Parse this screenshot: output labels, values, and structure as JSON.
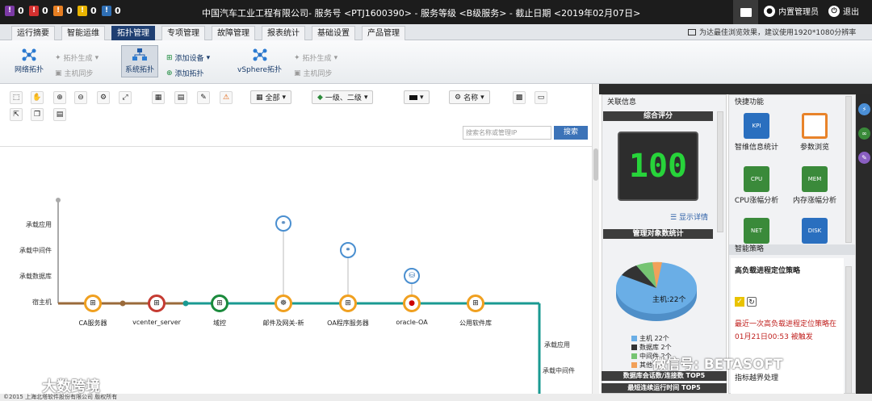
{
  "alarms": [
    {
      "color": "#7c3aa6",
      "count": "0",
      "icon": "alarm-critical-icon"
    },
    {
      "color": "#d3302f",
      "count": "0",
      "icon": "alarm-major-icon"
    },
    {
      "color": "#e67e22",
      "count": "0",
      "icon": "alarm-minor-icon"
    },
    {
      "color": "#e9b400",
      "count": "0",
      "icon": "alarm-warning-icon"
    },
    {
      "color": "#2f6fb5",
      "count": "0",
      "icon": "alarm-info-icon"
    }
  ],
  "header": {
    "title": "中国汽车工业工程有限公司- 服务号 <PTJ1600390> - 服务等级 <B级服务> - 截止日期 <2019年02月07日>",
    "user": "内置管理员",
    "logout": "退出",
    "hint": "为达最佳浏览效果，建议使用1920*1080分辨率"
  },
  "tabs": [
    "运行摘要",
    "智能运维",
    "拓扑管理",
    "专项管理",
    "故障管理",
    "报表统计",
    "基础设置",
    "产品管理"
  ],
  "active_tab": "拓扑管理",
  "ribbon": {
    "network_topo": "网络拓扑",
    "topo_gen": "拓扑生成",
    "host_sync": "主机同步",
    "system_topo": "系统拓扑",
    "add_device": "添加设备",
    "add_topo": "添加拓扑",
    "vsphere_topo": "vSphere拓扑",
    "topo_gen2": "拓扑生成",
    "host_sync2": "主机同步"
  },
  "toolbar": {
    "dd_all": "全部",
    "dd_level": "一级、二级",
    "dd_name": "名称",
    "search_placeholder": "搜索名称或管理IP",
    "search_btn": "搜索"
  },
  "lanes": {
    "left": [
      "承载应用",
      "承载中间件",
      "承载数据库",
      "宿主机"
    ],
    "right": [
      "承载应用",
      "承载中间件"
    ]
  },
  "nodes": [
    {
      "label": "CA服务器"
    },
    {
      "label": "vcenter_server"
    },
    {
      "label": "域控"
    },
    {
      "label": "邮件及网关-新"
    },
    {
      "label": "OA程序服务器"
    },
    {
      "label": "oracle-OA"
    },
    {
      "label": "公用软件库"
    }
  ],
  "related": {
    "title": "关联信息",
    "score_title": "综合评分",
    "score": "100",
    "detail": "显示详情",
    "stats_title": "管理对象数统计",
    "pie_label": "主机:22个",
    "legend": [
      {
        "label": "主机 22个",
        "color": "#6aaee6"
      },
      {
        "label": "数据库 2个",
        "color": "#333333"
      },
      {
        "label": "中间件 2个",
        "color": "#76c472"
      },
      {
        "label": "其他",
        "color": "#f2a15a"
      }
    ],
    "rank1": "数据库会话数/连接数 TOP5",
    "rank2": "最短连续运行时间 TOP5"
  },
  "quick": {
    "title": "快捷功能",
    "items": [
      {
        "label": "智维信息统计",
        "tag": "KPI",
        "color": "#2a6fbf"
      },
      {
        "label": "参数浏览",
        "tag": "",
        "color": "#e8832a"
      },
      {
        "label": "CPU涨幅分析",
        "tag": "CPU",
        "color": "#3a8a3a"
      },
      {
        "label": "内存涨幅分析",
        "tag": "MEM",
        "color": "#3a8a3a"
      },
      {
        "label": "",
        "tag": "NET",
        "color": "#3a8a3a"
      },
      {
        "label": "",
        "tag": "DISK",
        "color": "#2a6fbf"
      }
    ],
    "policy_title": "智能策略",
    "policy_name": "高负载进程定位策略",
    "policy_note": "最近一次高负载进程定位策略在 01月21日00:53 被触发",
    "policy2": "指标越界处理"
  },
  "watermark": {
    "wechat": "微信号: BETASOFT",
    "brand": "大数跨境"
  },
  "footer": "©2015 上海北塔软件股份有限公司 版权所有"
}
